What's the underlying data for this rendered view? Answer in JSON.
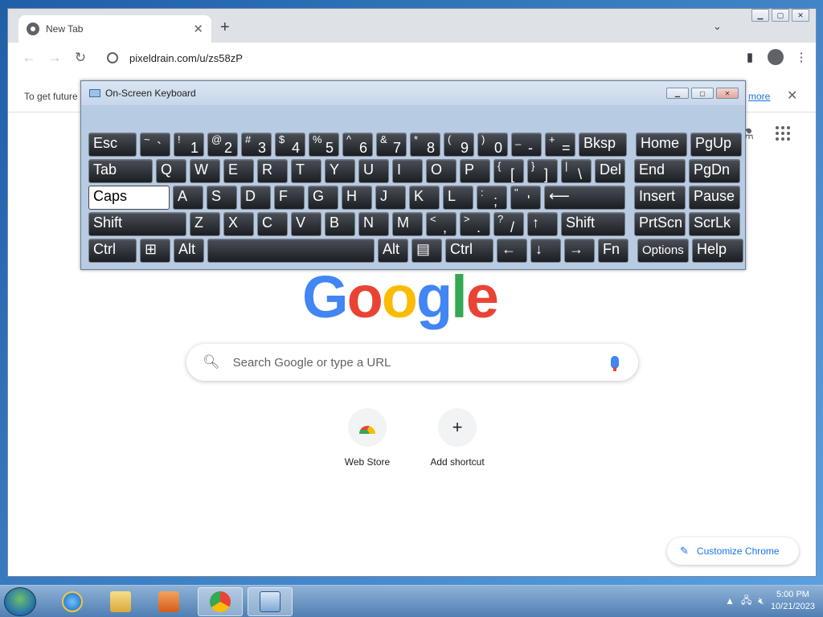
{
  "browser": {
    "tab_title": "New Tab",
    "url": "pixeldrain.com/u/zs58zP",
    "infobar_text": "To get future",
    "infobar_link": "more"
  },
  "ntp": {
    "logo_letters": [
      "G",
      "o",
      "o",
      "g",
      "l",
      "e"
    ],
    "search_placeholder": "Search Google or type a URL",
    "shortcuts": [
      {
        "label": "Web Store",
        "icon": "web-store-icon"
      },
      {
        "label": "Add shortcut",
        "icon": "plus-icon"
      }
    ],
    "customize_label": "Customize Chrome"
  },
  "osk": {
    "title": "On-Screen Keyboard",
    "rows": [
      [
        "Esc",
        "~ `",
        "! 1",
        "@ 2",
        "# 3",
        "$ 4",
        "% 5",
        "^ 6",
        "& 7",
        "* 8",
        "( 9",
        ") 0",
        "_ -",
        "+ =",
        "Bksp",
        "Home",
        "PgUp"
      ],
      [
        "Tab",
        "Q",
        "W",
        "E",
        "R",
        "T",
        "Y",
        "U",
        "I",
        "O",
        "P",
        "{ [",
        "} ]",
        "| \\",
        "Del",
        "End",
        "PgDn"
      ],
      [
        "Caps",
        "A",
        "S",
        "D",
        "F",
        "G",
        "H",
        "J",
        "K",
        "L",
        ": ;",
        "\" '",
        "⟵",
        "Insert",
        "Pause"
      ],
      [
        "Shift",
        "Z",
        "X",
        "C",
        "V",
        "B",
        "N",
        "M",
        "< ,",
        "> .",
        "? /",
        "↑",
        "Shift",
        "PrtScn",
        "ScrLk"
      ],
      [
        "Ctrl",
        "⊞",
        "Alt",
        "",
        "Alt",
        "▤",
        "Ctrl",
        "←",
        "↓",
        "→",
        "Fn",
        "Options",
        "Help"
      ]
    ]
  },
  "taskbar": {
    "time": "5:00 PM",
    "date": "10/21/2023"
  }
}
